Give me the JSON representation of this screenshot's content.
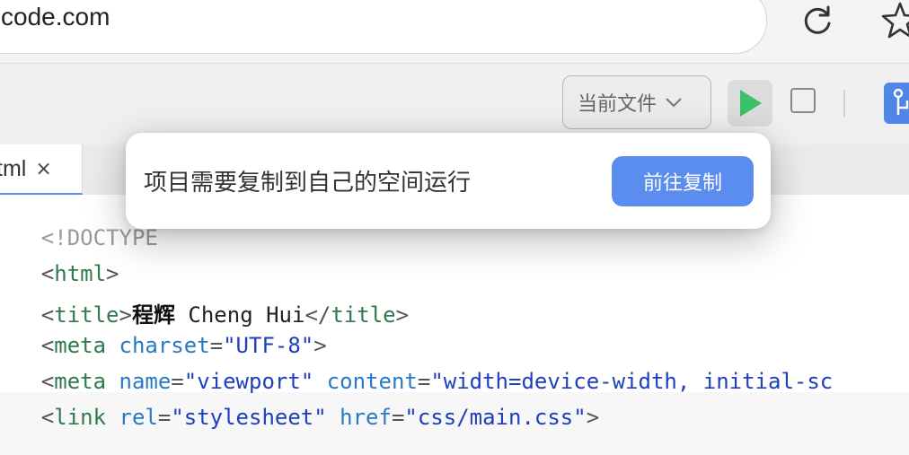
{
  "browser": {
    "url": "code.com",
    "reload_icon": "reload-icon",
    "star_icon": "star-icon"
  },
  "toolbar": {
    "file_select_label": "当前文件",
    "chevron_icon": "chevron-down-icon",
    "run_icon": "play-icon",
    "stop_icon": "stop-icon",
    "git_icon": "branch-icon",
    "run_color": "#3cc06a"
  },
  "tab": {
    "name": "tml",
    "close": "×"
  },
  "popup": {
    "message": "项目需要复制到自己的空间运行",
    "button": "前往复制"
  },
  "editor": {
    "lines": [
      {
        "doc": "<!DOCTYPE"
      },
      {
        "open": "<",
        "tag": "html",
        "close": ">"
      },
      {
        "open": "<",
        "tag": "title",
        "close": ">",
        "bold": "程辉",
        "text": " Cheng Hui",
        "etag_open": "</",
        "etag": "title",
        "etag_close": ">"
      },
      {
        "open": "<",
        "tag": "meta",
        "sp": " ",
        "attr": "charset",
        "eq": "=",
        "val": "\"UTF-8\"",
        "close": ">"
      },
      {
        "open": "<",
        "tag": "meta",
        "sp": " ",
        "attr": "name",
        "eq": "=",
        "val": "\"viewport\"",
        "sp2": " ",
        "attr2": "content",
        "eq2": "=",
        "val2": "\"width=device-width, initial-sc"
      },
      {
        "open": "<",
        "tag": "link",
        "sp": " ",
        "attr": "rel",
        "eq": "=",
        "val": "\"stylesheet\"",
        "sp2": " ",
        "attr2": "href",
        "eq2": "=",
        "val2": "\"css/main.css\"",
        "close": ">"
      }
    ]
  }
}
